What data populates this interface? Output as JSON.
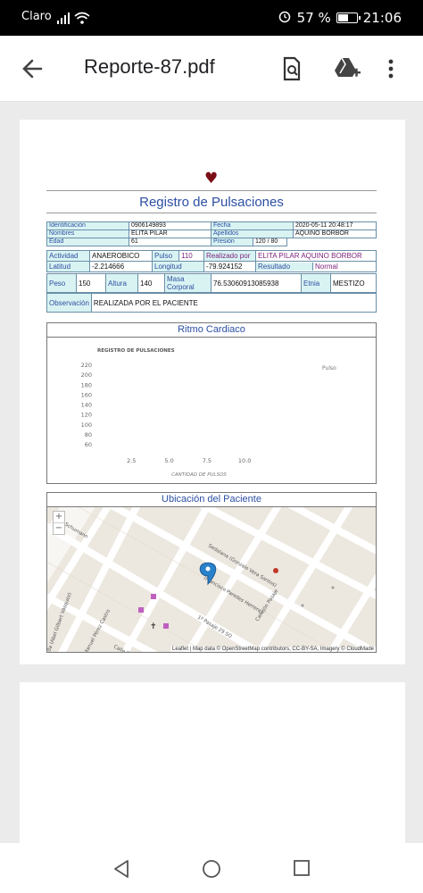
{
  "status": {
    "carrier": "Claro",
    "battery": "57 %",
    "battery_level": 0.57,
    "time": "21:06"
  },
  "appbar": {
    "title": "Reporte-87.pdf",
    "back_icon": "arrow-left-icon",
    "search_icon": "search-document-icon",
    "drive_icon": "add-to-drive-icon",
    "menu_icon": "more-vert-icon"
  },
  "report": {
    "title": "Registro de Pulsaciones",
    "row1": {
      "l1": "Identificación",
      "v1": "0906149893",
      "l2": "Fecha",
      "v2": "2020-05-11 20:48:17"
    },
    "row2": {
      "l1": "Nombres",
      "v1": "ELITA PILAR",
      "l2": "Apellidos",
      "v2": "AQUINO BORBOR"
    },
    "row3": {
      "l1": "Edad",
      "v1": "61",
      "l2": "Presión",
      "v2": "120 / 80"
    },
    "row4": {
      "l1": "Actividad",
      "v1": "ANAEROBICO",
      "l2": "Pulso",
      "v2": "110",
      "l3": "Realizado por",
      "v3": "ELITA PILAR AQUINO BORBOR"
    },
    "row5": {
      "l1": "Latitud",
      "v1": "-2.214666",
      "l2": "Longitud",
      "v2": "-79.924152",
      "l3": "Resultado",
      "v3": "Normal"
    },
    "row6": {
      "l1": "Peso",
      "v1": "150",
      "l2": "Altura",
      "v2": "140",
      "l3": "Masa Corporal",
      "v3": "76.53060913085938",
      "l4": "Etnia",
      "v4": "MESTIZO"
    },
    "row7": {
      "l1": "Observación",
      "v1": "REALIZADA POR EL PACIENTE"
    }
  },
  "chart_section_title": "Ritmo Cardiaco",
  "map_section_title": "Ubicación del Paciente",
  "map": {
    "attribution": "Leaflet | Map data © OpenStreetMap contributors, CC-BY-SA, Imagery © CloudMade",
    "zoom_in": "+",
    "zoom_out": "−",
    "streets": [
      {
        "name": "Sedalana (Gonzalo Vera Santos)"
      },
      {
        "name": "(Francisco Paredes Herrera)"
      },
      {
        "name": "1º Pasaje 29 SO"
      },
      {
        "name": "Callejón Pasaje"
      },
      {
        "name": "Calle B (Julio Jaramillo)"
      },
      {
        "name": "Manuel Pérez Castro"
      },
      {
        "name": "Calle Schumann"
      },
      {
        "name": "da (Abel Gilbert Vásquez)"
      }
    ]
  },
  "chart_data": {
    "type": "line",
    "title": "REGISTRO DE PULSACIONES",
    "xlabel": "CANTIDAD DE PULSOS",
    "ylabel": "",
    "xticks": [
      "2.5",
      "5.0",
      "7.5",
      "10.0"
    ],
    "yticks": [
      "220",
      "200",
      "180",
      "160",
      "140",
      "120",
      "100",
      "80",
      "60"
    ],
    "xlim": [
      0,
      12
    ],
    "ylim": [
      60,
      220
    ],
    "legend_position": "top-right",
    "series": [
      {
        "name": "Pulso",
        "x": [],
        "y": []
      }
    ],
    "grid": false
  }
}
